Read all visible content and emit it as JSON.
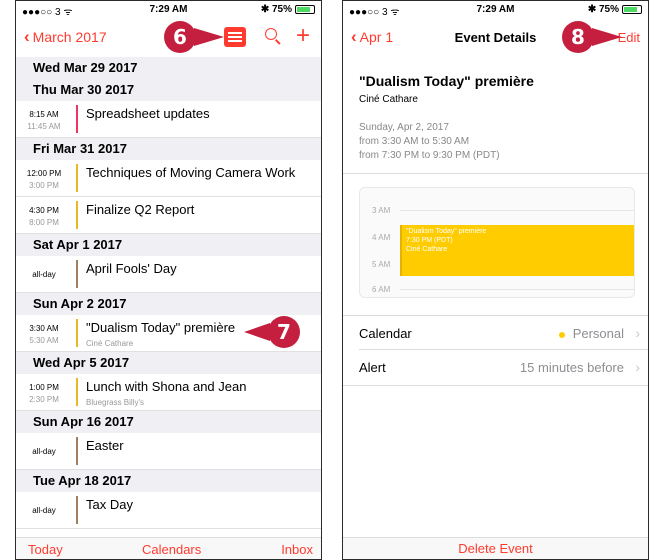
{
  "status_left": {
    "carrier": "●●●○○ 3 ᯤ",
    "time": "7:29 AM",
    "battery": "✱ 75%"
  },
  "status_right": {
    "carrier": "●●●○○ 3 ᯤ",
    "time": "7:29 AM",
    "battery": "✱ 75%"
  },
  "list_view": {
    "back_label": "March 2017",
    "days": [
      {
        "header": "Wed  Mar 29 2017",
        "events": []
      },
      {
        "header": "Thu  Mar 30 2017",
        "events": [
          {
            "start": "8:15 AM",
            "end": "11:45 AM",
            "title": "Spreadsheet updates",
            "location": ""
          }
        ]
      },
      {
        "header": "Fri  Mar 31 2017",
        "events": [
          {
            "start": "12:00 PM",
            "end": "3:00 PM",
            "title": "Techniques of Moving Camera Work",
            "location": ""
          },
          {
            "start": "4:30 PM",
            "end": "8:00 PM",
            "title": "Finalize Q2 Report",
            "location": ""
          }
        ]
      },
      {
        "header": "Sat  Apr 1 2017",
        "events": [
          {
            "allday": "all-day",
            "title": "April Fools' Day"
          }
        ]
      },
      {
        "header": "Sun  Apr 2 2017",
        "events": [
          {
            "start": "3:30 AM",
            "end": "5:30 AM",
            "title": "\"Dualism Today\" première",
            "location": "Ciné Cathare"
          }
        ]
      },
      {
        "header": "Wed  Apr 5 2017",
        "events": [
          {
            "start": "1:00 PM",
            "end": "2:30 PM",
            "title": "Lunch with Shona and Jean",
            "location": "Bluegrass Billy's"
          }
        ]
      },
      {
        "header": "Sun  Apr 16 2017",
        "events": [
          {
            "allday": "all-day",
            "title": "Easter"
          }
        ]
      },
      {
        "header": "Tue  Apr 18 2017",
        "events": [
          {
            "allday": "all-day",
            "title": "Tax Day"
          }
        ]
      }
    ],
    "bottom": {
      "today": "Today",
      "calendars": "Calendars",
      "inbox": "Inbox"
    },
    "colors": {
      "accent": "#ff3b30",
      "calendar_red": "#e8385f",
      "calendar_yellow": "#e8b923",
      "calendar_brown": "#a08060"
    }
  },
  "details_view": {
    "back_label": "Apr 1",
    "title": "Event Details",
    "edit_label": "Edit",
    "event_title": "\"Dualism Today\" première",
    "location": "Ciné Cathare",
    "date_line": "Sunday, Apr 2, 2017",
    "time_line": "from 3:30 AM to 5:30 AM",
    "tz_line": "from 7:30 PM to 9:30 PM (PDT)",
    "timeline": {
      "labels": [
        "3 AM",
        "4 AM",
        "5 AM",
        "6 AM"
      ],
      "event_title": "\"Dualism Today\" première",
      "event_time": "7:30 PM (PDT)",
      "event_location": "Ciné Cathare"
    },
    "calendar_label": "Calendar",
    "calendar_value": "Personal",
    "alert_label": "Alert",
    "alert_value": "15 minutes before",
    "delete_label": "Delete Event"
  },
  "callouts": {
    "c6": "6",
    "c7": "7",
    "c8": "8"
  }
}
